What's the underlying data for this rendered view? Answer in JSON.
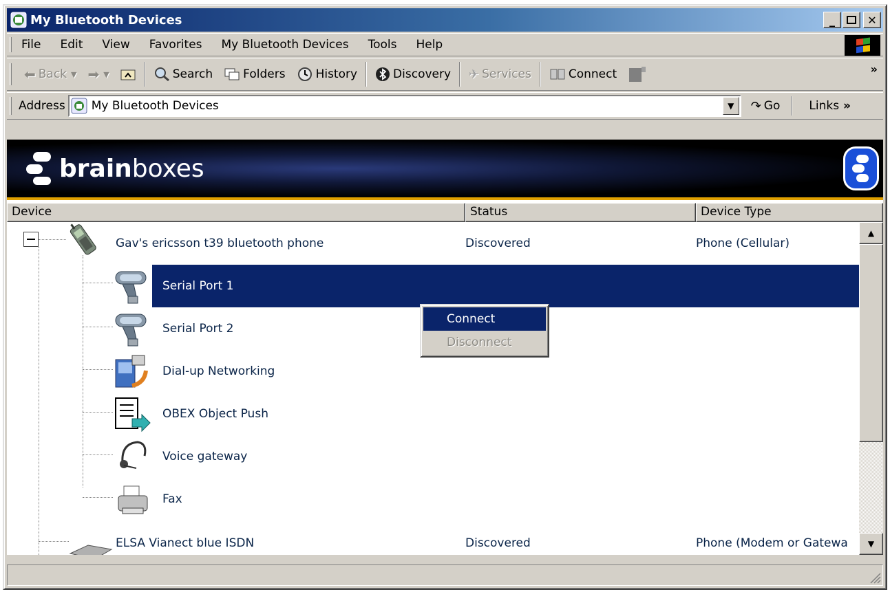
{
  "window": {
    "title": "My Bluetooth Devices"
  },
  "menu": [
    "File",
    "Edit",
    "View",
    "Favorites",
    "My Bluetooth Devices",
    "Tools",
    "Help"
  ],
  "toolbar": {
    "back": "Back",
    "search": "Search",
    "folders": "Folders",
    "history": "History",
    "discovery": "Discovery",
    "services": "Services",
    "connect": "Connect",
    "more": "»"
  },
  "address": {
    "label": "Address",
    "value": "My Bluetooth Devices",
    "go": "Go",
    "links": "Links",
    "links_more": "»"
  },
  "banner": {
    "brand_bold": "brain",
    "brand_light": "boxes"
  },
  "columns": {
    "device": "Device",
    "status": "Status",
    "device_type": "Device Type"
  },
  "devices": [
    {
      "name": "Gav's ericsson t39 bluetooth phone",
      "status": "Discovered",
      "type": "Phone (Cellular)",
      "icon": "mobile-phone-icon",
      "services": [
        {
          "name": "Serial Port 1",
          "icon": "serial-port-icon",
          "selected": true
        },
        {
          "name": "Serial Port 2",
          "icon": "serial-port-icon",
          "selected": false
        },
        {
          "name": "Dial-up Networking",
          "icon": "dialup-networking-icon",
          "selected": false
        },
        {
          "name": "OBEX Object Push",
          "icon": "obex-push-icon",
          "selected": false
        },
        {
          "name": "Voice gateway",
          "icon": "headset-icon",
          "selected": false
        },
        {
          "name": "Fax",
          "icon": "fax-icon",
          "selected": false
        }
      ]
    },
    {
      "name": "ELSA Vianect blue ISDN",
      "status": "Discovered",
      "type": "Phone (Modem or Gatewa",
      "icon": "modem-icon"
    }
  ],
  "context_menu": {
    "connect": "Connect",
    "disconnect": "Disconnect"
  },
  "colors": {
    "selection": "#0a246a",
    "accent": "#e0a000",
    "title_start": "#0a246a",
    "title_end": "#a6caf0"
  }
}
